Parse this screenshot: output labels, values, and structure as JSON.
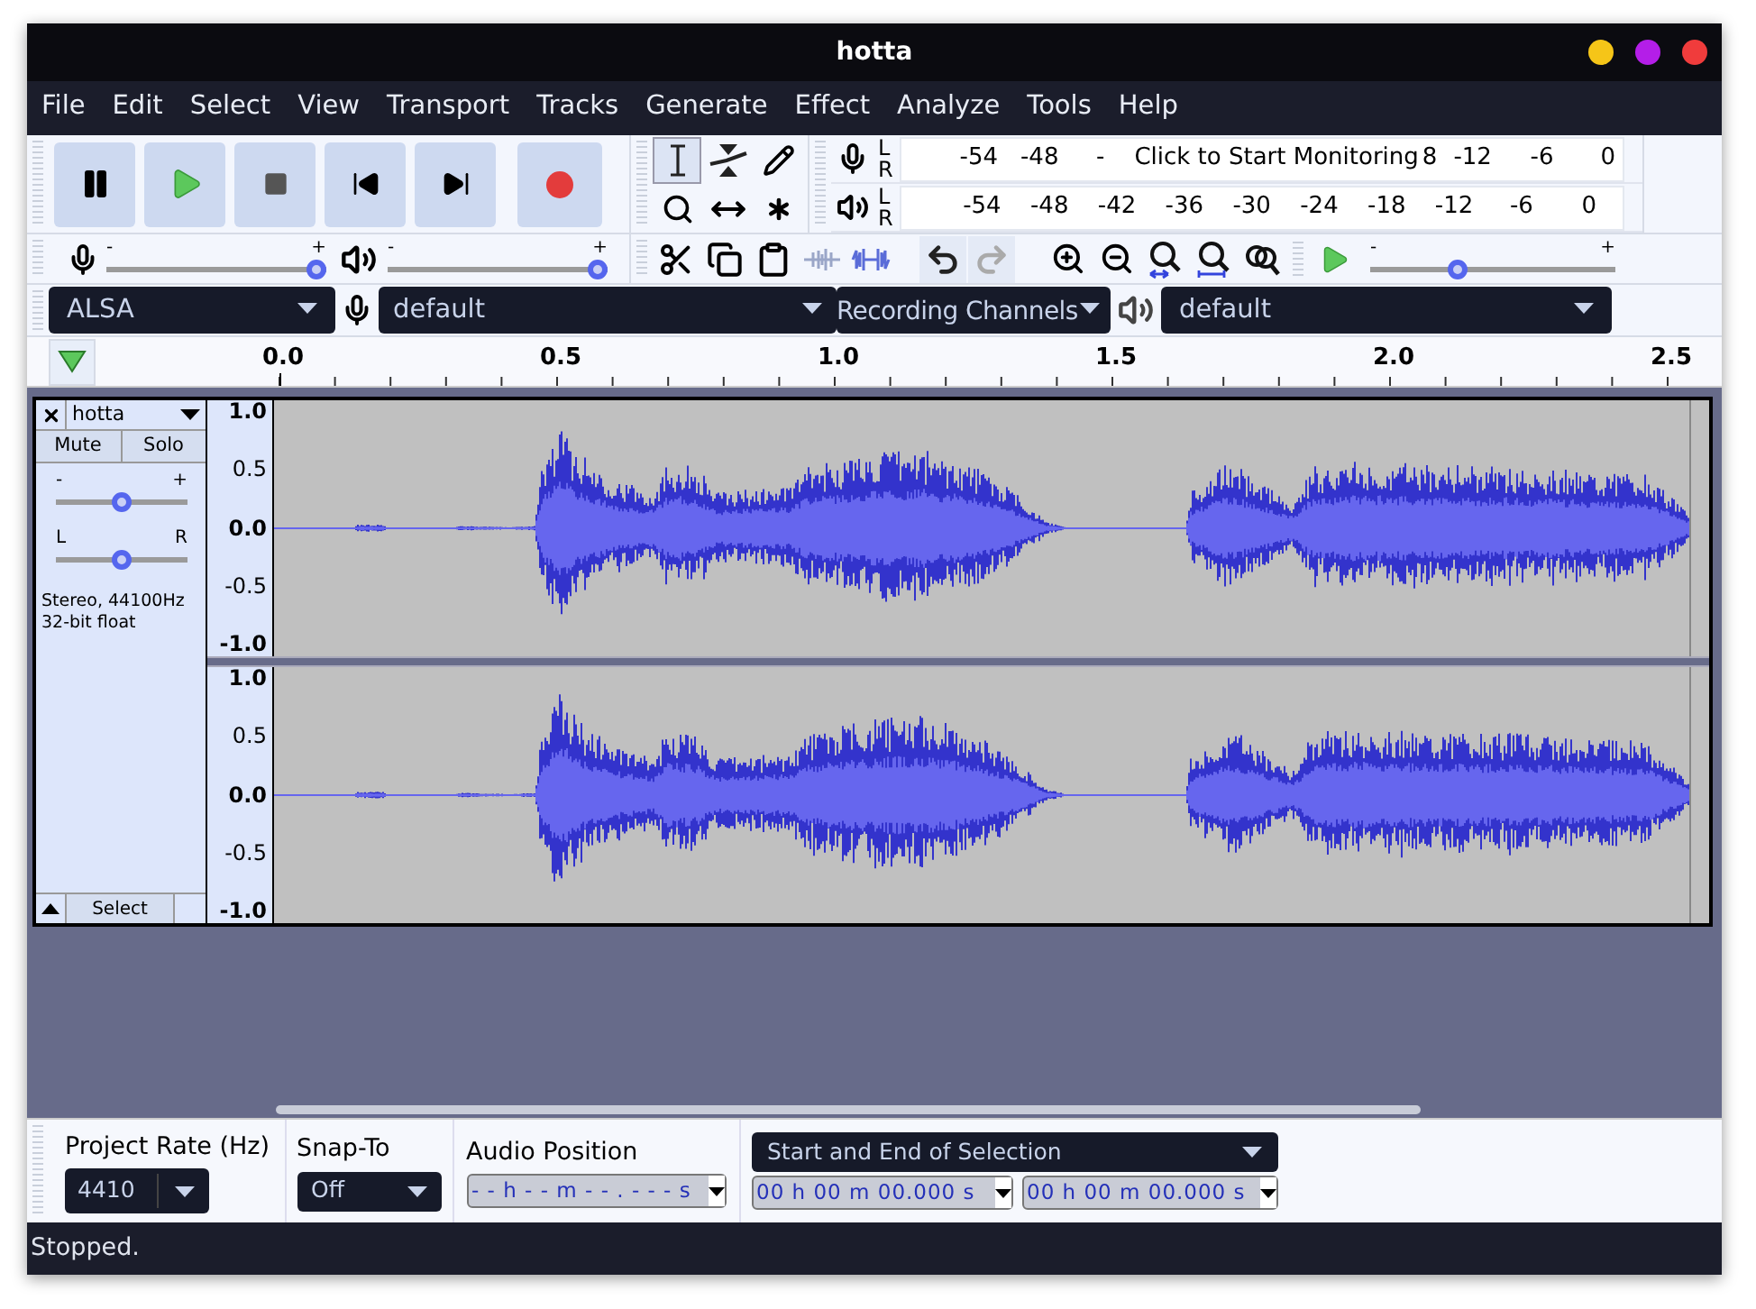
{
  "window": {
    "title": "hotta"
  },
  "menu": [
    "File",
    "Edit",
    "Select",
    "View",
    "Transport",
    "Tracks",
    "Generate",
    "Effect",
    "Analyze",
    "Tools",
    "Help"
  ],
  "tools": [
    {
      "kind": "select",
      "selected": true
    },
    {
      "kind": "envelope",
      "selected": false
    },
    {
      "kind": "draw",
      "selected": false
    },
    {
      "kind": "zoom",
      "selected": false
    },
    {
      "kind": "timeshift",
      "selected": false
    },
    {
      "kind": "multi",
      "selected": false
    }
  ],
  "record_meter": {
    "channels": [
      "L",
      "R"
    ],
    "labels_before": [
      "-54",
      "-48",
      "-"
    ],
    "overlay": "Click to Start Monitoring",
    "labels_after": [
      "8",
      "-12",
      "-6",
      "0"
    ]
  },
  "playback_meter": {
    "channels": [
      "L",
      "R"
    ],
    "labels": [
      "-54",
      "-48",
      "-42",
      "-36",
      "-30",
      "-24",
      "-18",
      "-12",
      "-6",
      "0"
    ]
  },
  "mixer": [
    {
      "kind": "record",
      "min_label": "-",
      "max_label": "+",
      "level": 1
    },
    {
      "kind": "playback",
      "min_label": "-",
      "max_label": "+",
      "level": 1
    }
  ],
  "history": [
    {
      "kind": "undo",
      "disabled": false
    },
    {
      "kind": "redo",
      "disabled": true
    }
  ],
  "play_at_speed": {
    "min_label": "-",
    "max_label": "+",
    "level": 0.34
  },
  "devices": {
    "host": "ALSA",
    "recording_device": "default",
    "channels": "Recording Channels",
    "playback_device": "default"
  },
  "ruler": [
    "0.0",
    "0.5",
    "1.0",
    "1.5",
    "2.0",
    "2.5"
  ],
  "track": {
    "name": "hotta",
    "mute": "Mute",
    "solo": "Solo",
    "gain": {
      "min_label": "-",
      "max_label": "+",
      "level": 0.5
    },
    "pan": {
      "min_label": "L",
      "max_label": "R",
      "level": 0.5
    },
    "info": [
      "Stereo, 44100Hz",
      "32-bit float"
    ],
    "select": "Select",
    "channels": [
      {
        "scale": [
          "1.0",
          "0.5",
          "0.0",
          "-0.5",
          "-1.0"
        ]
      },
      {
        "scale": [
          "1.0",
          "0.5",
          "0.0",
          "-0.5",
          "-1.0"
        ]
      }
    ]
  },
  "selection_bar": {
    "rate_label": "Project Rate (Hz)",
    "rate": "4410",
    "snap_label": "Snap-To",
    "snap": "Off",
    "position_label": "Audio Position",
    "position": "- - h - - m - - . - - - s",
    "selection_mode": "Start and End of Selection",
    "start": "00 h 00 m 00.000 s",
    "end": "00 h 00 m 00.000 s"
  },
  "status": "Stopped."
}
